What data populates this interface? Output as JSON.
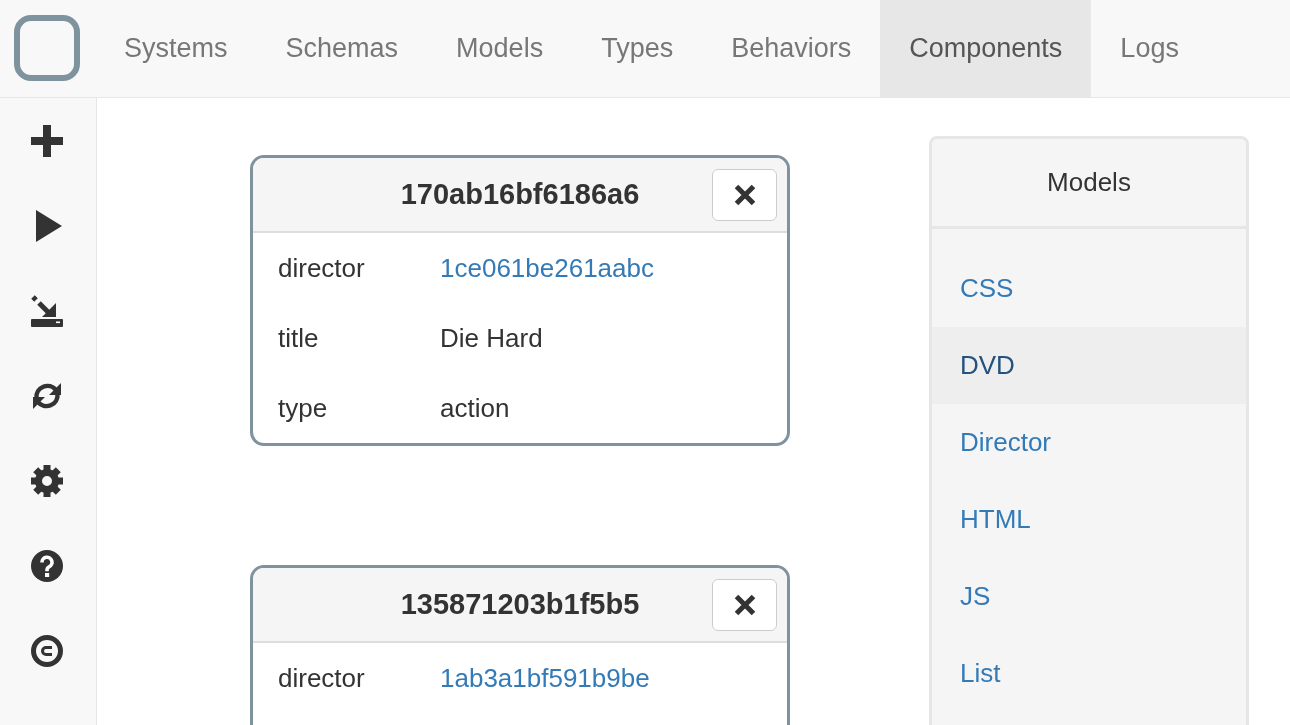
{
  "nav_tabs": [
    {
      "label": "Systems",
      "selected": false
    },
    {
      "label": "Schemas",
      "selected": false
    },
    {
      "label": "Models",
      "selected": false
    },
    {
      "label": "Types",
      "selected": false
    },
    {
      "label": "Behaviors",
      "selected": false
    },
    {
      "label": "Components",
      "selected": true
    },
    {
      "label": "Logs",
      "selected": false
    }
  ],
  "components": [
    {
      "title": "170ab16bf6186a6",
      "fields": [
        {
          "label": "director",
          "value": "1ce061be261aabc",
          "kind": "link"
        },
        {
          "label": "title",
          "value": "Die Hard",
          "kind": "text"
        },
        {
          "label": "type",
          "value": "action",
          "kind": "text"
        }
      ]
    },
    {
      "title": "135871203b1f5b5",
      "fields": [
        {
          "label": "director",
          "value": "1ab3a1bf591b9be",
          "kind": "link"
        }
      ]
    }
  ],
  "models_panel": {
    "title": "Models",
    "items": [
      {
        "label": "CSS",
        "selected": false
      },
      {
        "label": "DVD",
        "selected": true
      },
      {
        "label": "Director",
        "selected": false
      },
      {
        "label": "HTML",
        "selected": false
      },
      {
        "label": "JS",
        "selected": false
      },
      {
        "label": "List",
        "selected": false
      }
    ]
  }
}
